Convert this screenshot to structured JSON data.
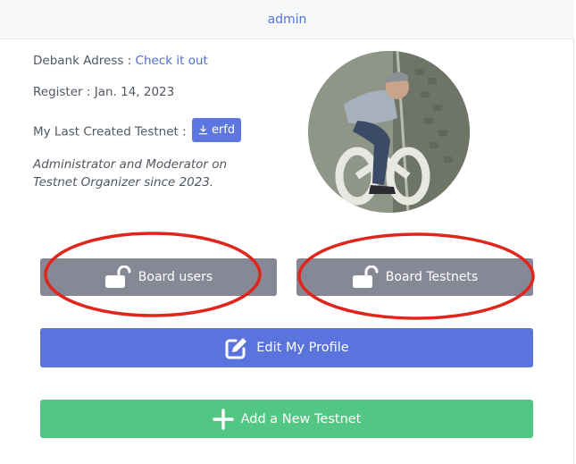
{
  "header": {
    "title": "admin"
  },
  "profile": {
    "debank_label": "Debank Adress : ",
    "debank_link": "Check it out",
    "register": "Register : Jan. 14, 2023",
    "last_testnet_label": "My Last Created Testnet : ",
    "last_testnet_tag": "erfd",
    "bio_line1": "Administrator and Moderator on",
    "bio_line2": "Testnet Organizer since 2023."
  },
  "buttons": {
    "board_users": "Board users",
    "board_testnets": "Board Testnets",
    "edit_profile": "Edit My Profile",
    "add_testnet": "Add a New Testnet"
  },
  "icons": {
    "lock": "unlock-icon",
    "edit": "edit-icon",
    "plus": "plus-icon",
    "download": "download-icon"
  },
  "colors": {
    "header_text": "#5474d6",
    "link": "#4d6fd8",
    "tag_bg": "#5c78e0",
    "gray_button": "#878895",
    "edit_button": "#5a73dd",
    "add_button": "#52c683",
    "annotation": "#e0261c"
  }
}
